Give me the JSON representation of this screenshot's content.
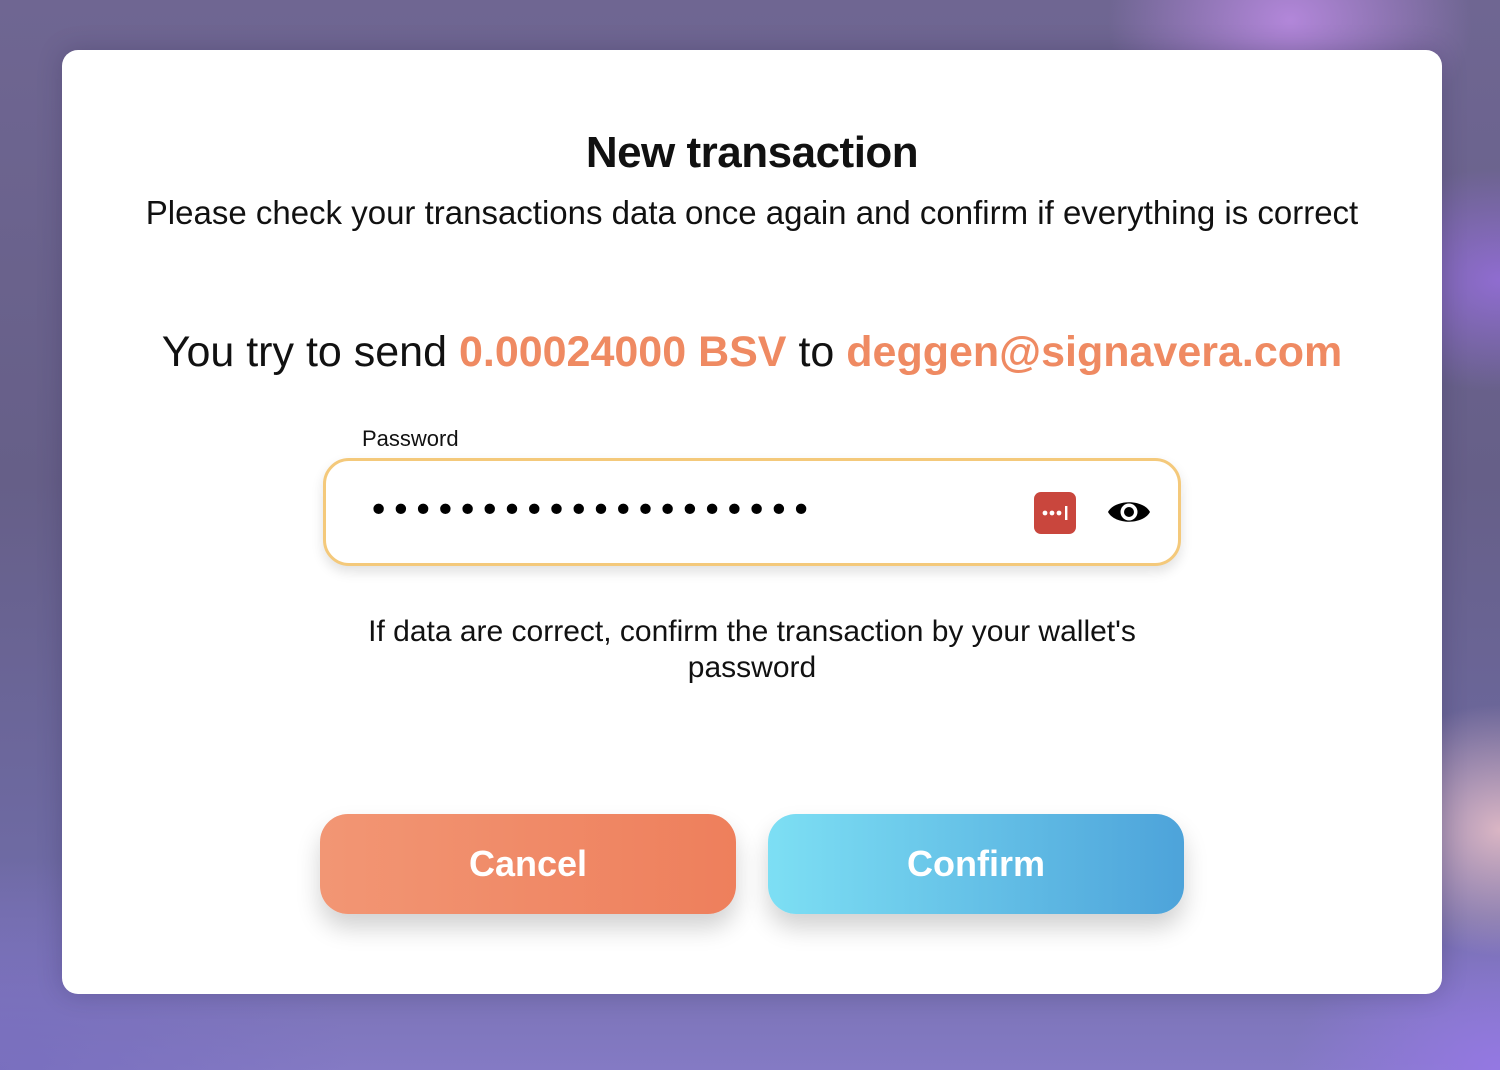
{
  "modal": {
    "title": "New transaction",
    "subtitle": "Please check your transactions data once again and confirm if everything is correct",
    "send_prefix": "You try to send",
    "amount": "0.00024000 BSV",
    "send_middle": "to",
    "recipient": "deggen@signavera.com",
    "password": {
      "label": "Password",
      "masked_value": "••••••••••••••••••••",
      "password_manager_icon": "password-manager-icon",
      "toggle_icon": "eye-icon"
    },
    "hint": "If data are correct, confirm the transaction by your wallet's password",
    "buttons": {
      "cancel_label": "Cancel",
      "confirm_label": "Confirm"
    }
  },
  "colors": {
    "accent": "#ef8a62",
    "field_border": "#f4c97b",
    "cancel_gradient": [
      "#f29674",
      "#ee7f5c"
    ],
    "confirm_gradient": [
      "#7ddff4",
      "#4da3da"
    ],
    "password_manager_icon_bg": "#c9463d"
  }
}
